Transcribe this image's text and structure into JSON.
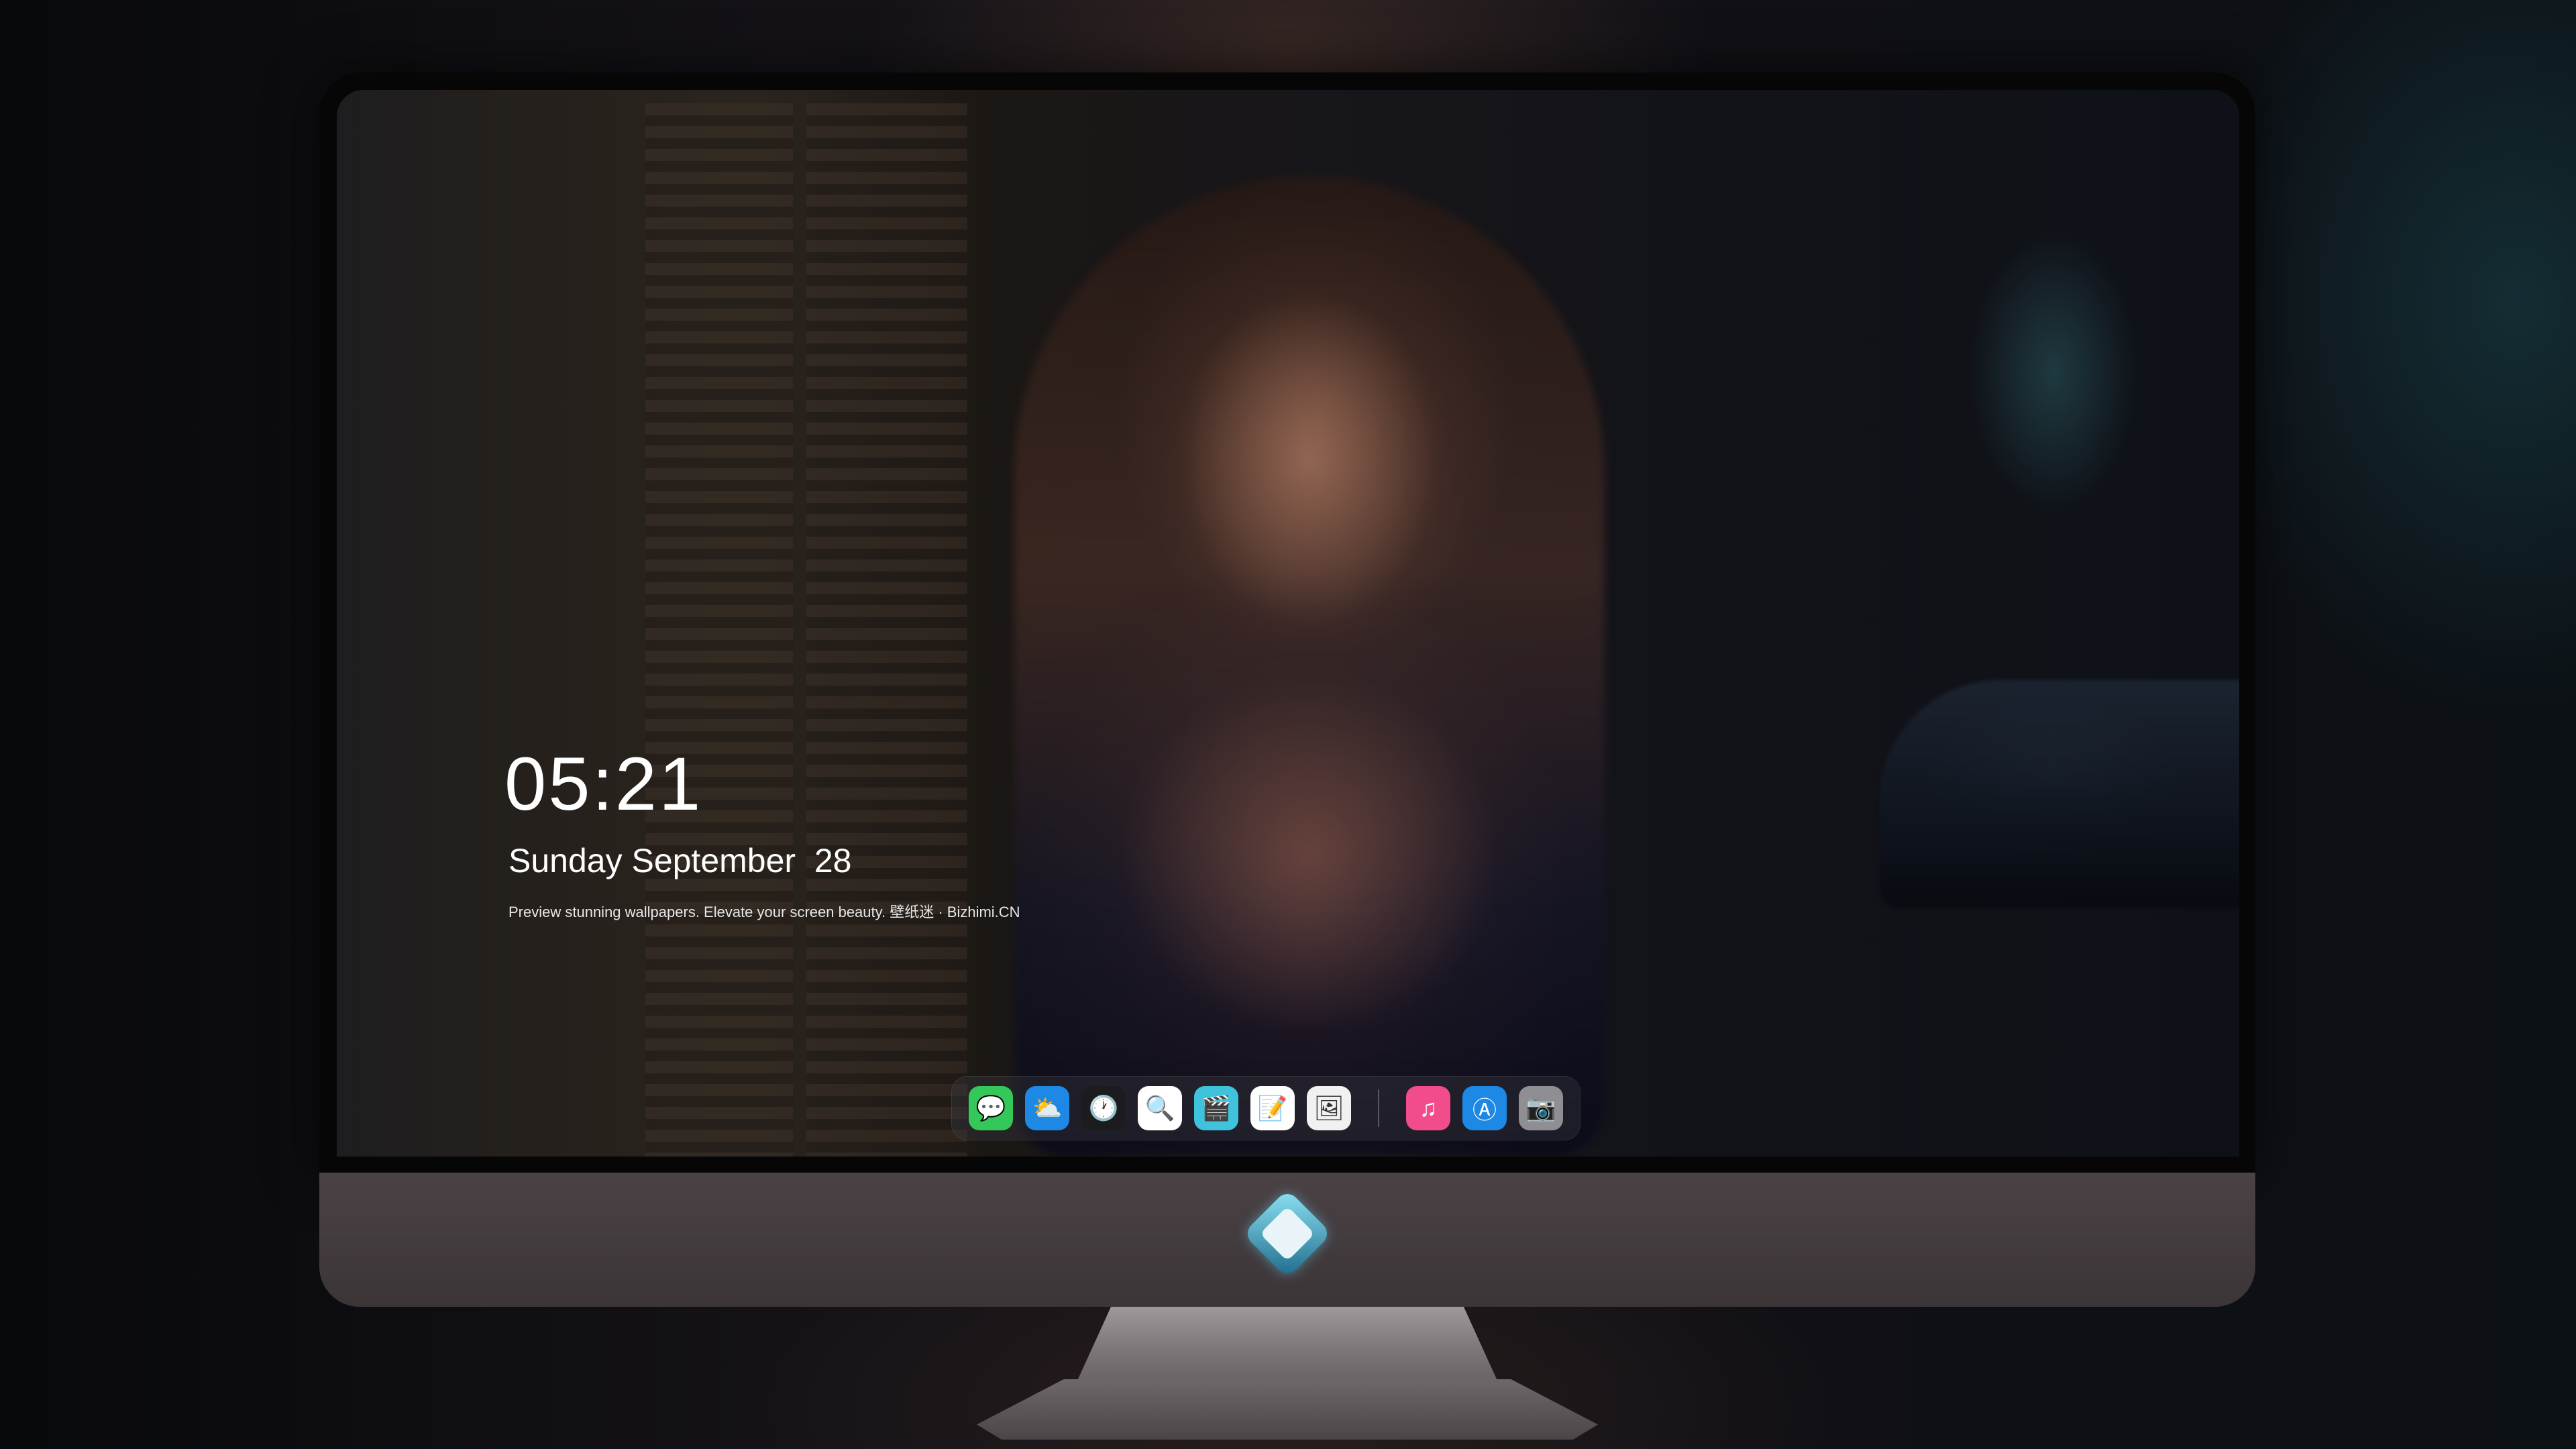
{
  "lockscreen": {
    "time": "05:21",
    "date": "Sunday September  28",
    "tagline": "Preview stunning wallpapers. Elevate your screen beauty. 壁纸迷 · Bizhimi.CN"
  },
  "dock": {
    "apps": [
      {
        "name": "messages-icon",
        "glyph": "💬",
        "color": "#34c759"
      },
      {
        "name": "weather-icon",
        "glyph": "⛅",
        "color": "#1e88e5"
      },
      {
        "name": "clock-icon",
        "glyph": "🕐",
        "color": "#1c1c1e"
      },
      {
        "name": "preview-icon",
        "glyph": "🔍",
        "color": "#ffffff"
      },
      {
        "name": "clapper-icon",
        "glyph": "🎬",
        "color": "#3fc3dd"
      },
      {
        "name": "notes-icon",
        "glyph": "📝",
        "color": "#ffffff"
      },
      {
        "name": "photos-icon",
        "glyph": "🖼",
        "color": "#f1f1f1"
      },
      {
        "name": "music-icon",
        "glyph": "♫",
        "color": "#f24c8c"
      },
      {
        "name": "app-store-icon",
        "glyph": "Ⓐ",
        "color": "#1e88e5"
      },
      {
        "name": "camera-icon",
        "glyph": "📷",
        "color": "#8e8e93"
      }
    ]
  },
  "logo": {
    "name": "brand-logo-icon"
  }
}
